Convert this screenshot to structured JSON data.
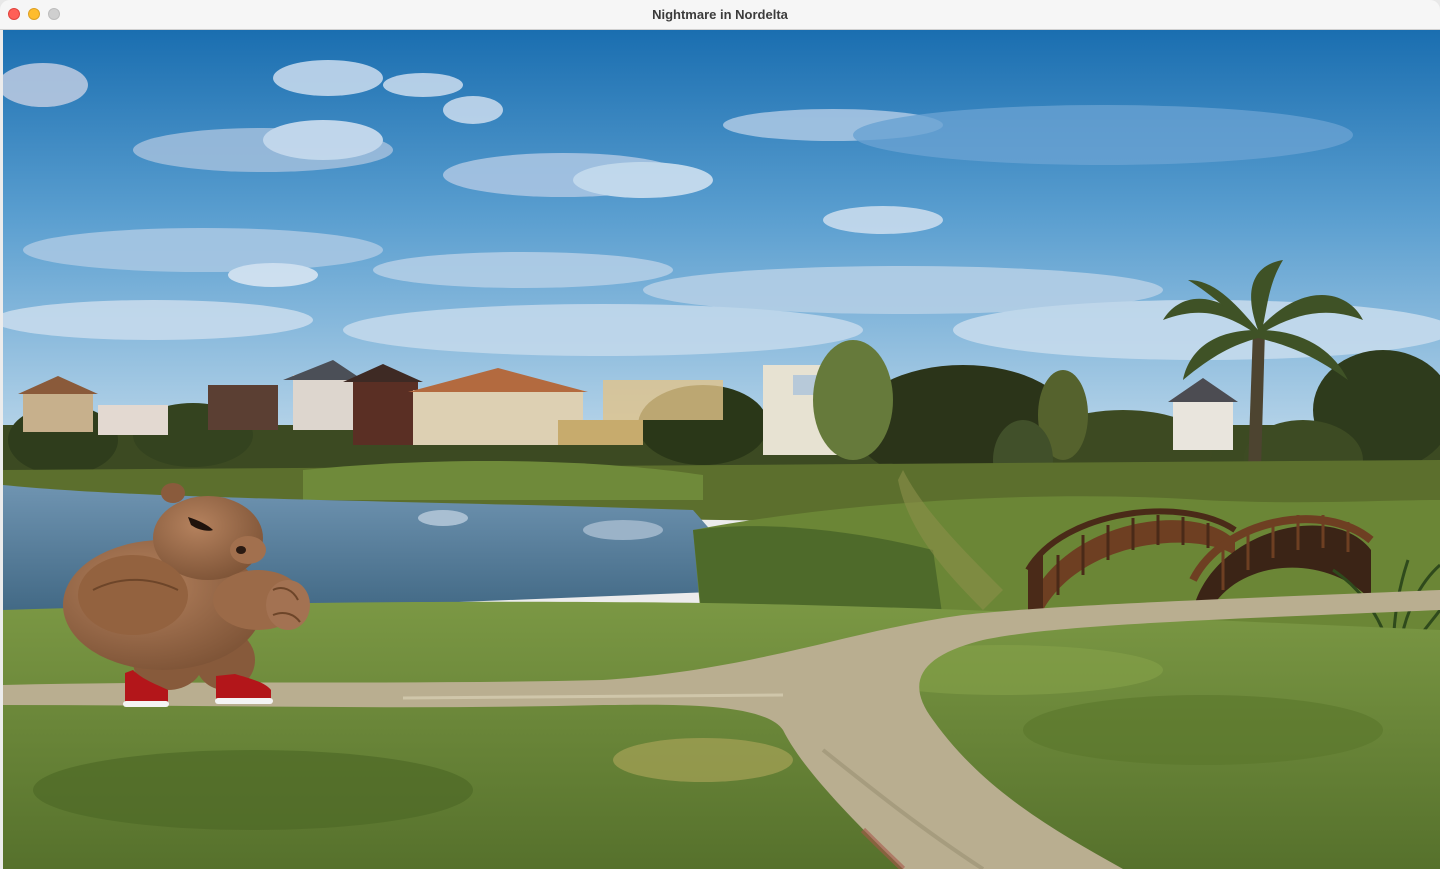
{
  "window": {
    "title": "Nightmare in Nordelta"
  },
  "scene": {
    "background": "nordelta-lakeside-park",
    "elements": [
      "sky",
      "clouds",
      "houses",
      "trees",
      "palm-tree",
      "lake",
      "arched-bridges",
      "paved-path",
      "grass"
    ],
    "player": {
      "character": "muscular-capybara",
      "shoes": "red-sneakers"
    },
    "colors": {
      "sky_top": "#1f73b4",
      "sky_bottom": "#b9d5e8",
      "lake": "#5a7e9c",
      "grass": "#6d8a3a",
      "path": "#b8ad8e",
      "character": "#9a6a4a",
      "shoes": "#b51818"
    }
  }
}
